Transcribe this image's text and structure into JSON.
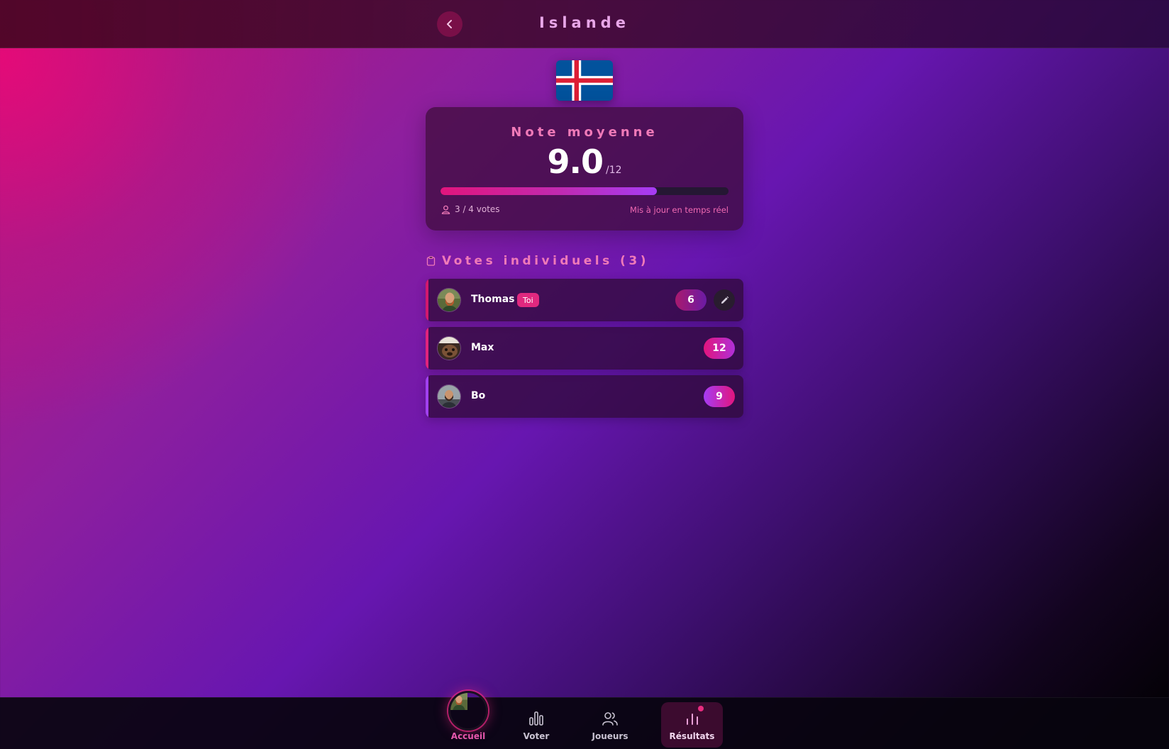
{
  "header": {
    "title": "Islande",
    "back_icon": "chevron-left-icon"
  },
  "colors": {
    "accent_pink": "#e2157d",
    "accent_purple": "#a63cf5",
    "title_pink": "#f07ab8"
  },
  "summary": {
    "label": "Note moyenne",
    "score": "9.0",
    "max": "/12",
    "progress_fraction": 0.75,
    "votes_text": "3 / 4 votes",
    "realtime_text": "Mis à jour en temps réel"
  },
  "individual_votes": {
    "title": "Votes individuels (3)",
    "icon": "clipboard-icon",
    "items": [
      {
        "name": "Thomas",
        "badge": "Toi",
        "score": "6",
        "editable": true,
        "accent": "#d2186e"
      },
      {
        "name": "Max",
        "badge": "",
        "score": "12",
        "editable": false,
        "accent": "#e1237d"
      },
      {
        "name": "Bo",
        "badge": "",
        "score": "9",
        "editable": false,
        "accent": "#a140f0"
      }
    ]
  },
  "nav": {
    "home": "Accueil",
    "vote": "Voter",
    "players": "Joueurs",
    "results": "Résultats"
  }
}
